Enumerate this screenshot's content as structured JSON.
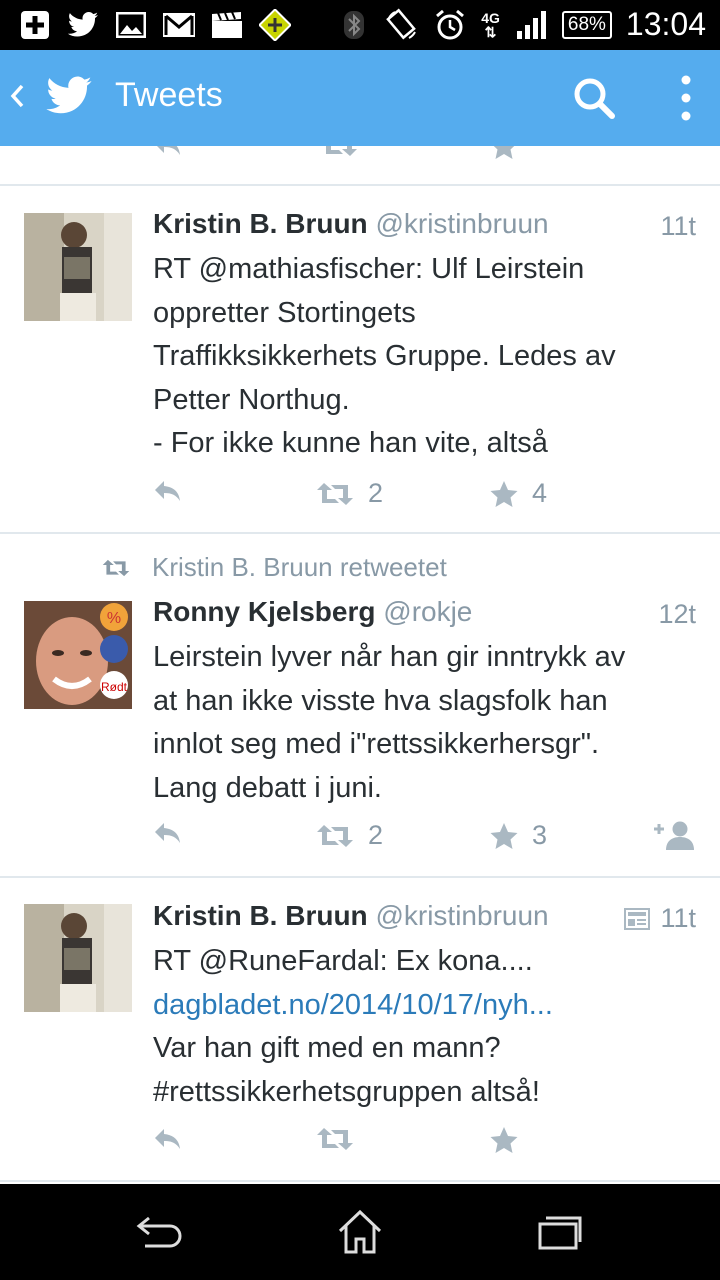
{
  "status_bar": {
    "time": "13:04",
    "battery": "68%",
    "network": "4G",
    "left_icons": [
      "plus-icon",
      "twitter-bird-icon",
      "image-icon",
      "gmail-icon",
      "clapper-icon",
      "app-icon"
    ],
    "right_icons": [
      "bluetooth-icon",
      "rotate-icon",
      "alarm-icon",
      "signal-icon",
      "battery-icon"
    ]
  },
  "header": {
    "title": "Tweets",
    "color": "#55ACEE"
  },
  "tweets": [
    {
      "name": "Kristin B. Bruun",
      "handle": "@kristinbruun",
      "time": "11t",
      "lines": [
        "RT @mathiasfischer: Ulf Leirstein",
        "oppretter Stortingets",
        "Traffikksikkerhets Gruppe. Ledes av",
        "Petter Northug.",
        "- For ikke kunne han vite, altså"
      ],
      "retweets": "2",
      "favorites": "4"
    },
    {
      "retweeted_by": "Kristin B. Bruun retweetet",
      "name": "Ronny Kjelsberg",
      "handle": "@rokje",
      "time": "12t",
      "lines": [
        "Leirstein lyver når han gir inntrykk av",
        "at han ikke visste hva slagsfolk han",
        "innlot seg med i\"rettssikkerhersgr\".",
        "Lang debatt i juni."
      ],
      "retweets": "2",
      "favorites": "3"
    },
    {
      "name": "Kristin B. Bruun",
      "handle": "@kristinbruun",
      "time": "11t",
      "lines": [
        "RT @RuneFardal: Ex kona....",
        "dagbladet.no/2014/10/17/nyh...",
        "Var han gift med en mann?",
        "#rettssikkerhetsgruppen altså!"
      ],
      "retweets": "",
      "favorites": ""
    }
  ]
}
